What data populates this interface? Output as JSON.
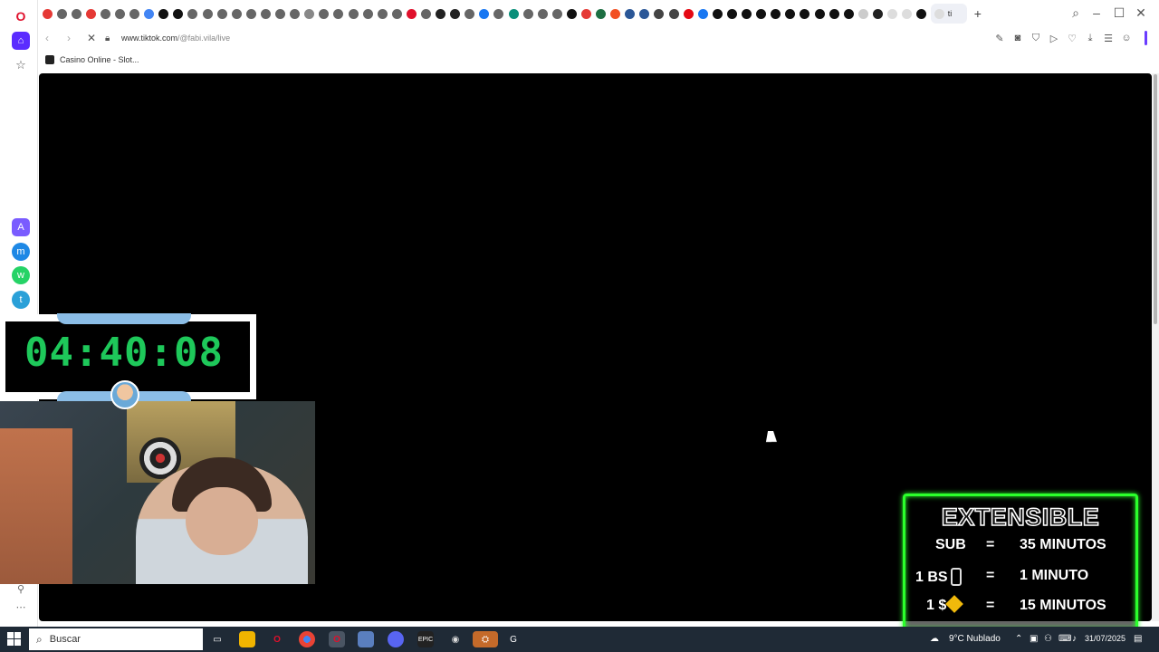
{
  "browser": {
    "url_domain": "www.tiktok.com",
    "url_path": "/@fabi.vila/live",
    "active_tab_label": "ti",
    "bookmark_label": "Casino Online - Slot..."
  },
  "stream": {
    "timer": "04:40:08",
    "extensible": {
      "title": "EXTENSIBLE",
      "row1_left": "SUB",
      "row1_eq": "=",
      "row1_right": "35 MINUTOS",
      "row2_left": "1 BS",
      "row2_eq": "=",
      "row2_right": "1 MINUTO",
      "row3_left": "1 $",
      "row3_eq": "=",
      "row3_right": "15 MINUTOS"
    }
  },
  "taskbar": {
    "search_placeholder": "Buscar",
    "weather": "9°C Nublado",
    "date": "31/07/2025"
  },
  "colors": {
    "timer_green": "#1ec85a",
    "ext_border": "#2bff2b",
    "opera_red": "#e0102c"
  }
}
